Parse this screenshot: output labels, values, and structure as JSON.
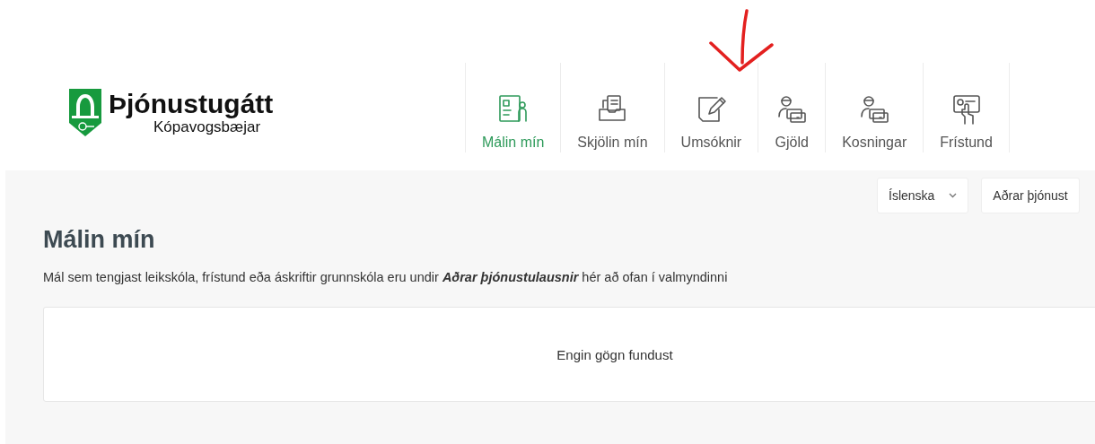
{
  "logo": {
    "title": "Þjónustugátt",
    "subtitle": "Kópavogsbæjar"
  },
  "nav": [
    {
      "label": "Málin mín",
      "kind": "cases",
      "selected": true
    },
    {
      "label": "Skjölin mín",
      "kind": "documents",
      "selected": false
    },
    {
      "label": "Umsóknir",
      "kind": "applications",
      "selected": false
    },
    {
      "label": "Gjöld",
      "kind": "fees",
      "selected": false
    },
    {
      "label": "Kosningar",
      "kind": "elections",
      "selected": false
    },
    {
      "label": "Frístund",
      "kind": "leisure",
      "selected": false
    }
  ],
  "toolbar": {
    "language": "Íslenska",
    "other_services": "Aðrar þjónust"
  },
  "page": {
    "title": "Málin mín",
    "description": "Mál sem tengjast leikskóla, frístund eða áskriftir grunnskóla eru undir **Aðrar þjónustulausnir** hér að ofan í valmyndinni",
    "empty_message": "Engin gögn fundust"
  }
}
